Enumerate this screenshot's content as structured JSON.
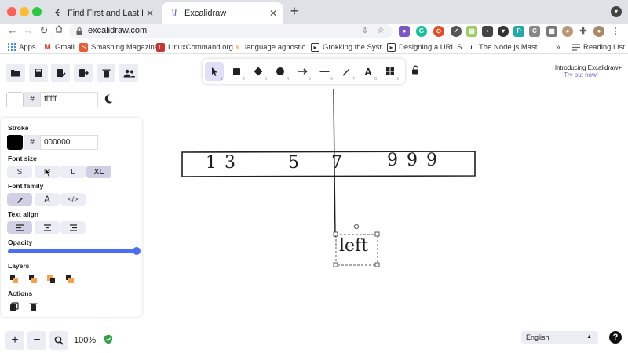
{
  "browser": {
    "tabs": [
      {
        "title": "Find First and Last Position of E",
        "active": false
      },
      {
        "title": "Excalidraw",
        "active": true
      }
    ],
    "url": "excalidraw.com",
    "reading_list": "Reading List",
    "bookmarks": [
      {
        "label": "Apps",
        "icon": "apps-grid-icon"
      },
      {
        "label": "Gmail",
        "icon": "gmail-icon"
      },
      {
        "label": "Smashing Magazine",
        "icon": "smashing-icon"
      },
      {
        "label": "LinuxCommand.org",
        "icon": "linux-icon"
      },
      {
        "label": "language agnostic...",
        "icon": "bookmark-icon"
      },
      {
        "label": "Grokking the Syst...",
        "icon": "grokking-icon"
      },
      {
        "label": "Designing a URL S...",
        "icon": "grokking-icon"
      },
      {
        "label": "The Node.js Mast...",
        "icon": "info-icon"
      }
    ]
  },
  "app": {
    "canvas_bg_hash": "#",
    "canvas_bg_value": "ffffff",
    "stroke_label": "Stroke",
    "stroke_hash": "#",
    "stroke_value": "000000",
    "font_size_label": "Font size",
    "font_sizes": [
      "S",
      "M",
      "L",
      "XL"
    ],
    "font_family_label": "Font family",
    "font_family_a": "A",
    "font_family_code": "</>",
    "text_align_label": "Text align",
    "opacity_label": "Opacity",
    "opacity_value": 100,
    "layers_label": "Layers",
    "actions_label": "Actions",
    "font_family_brand": "A",
    "promo_line1": "Introducing Excalidraw+",
    "promo_line2": "Try out now!",
    "zoom": "100%",
    "language": "English",
    "help": "?"
  },
  "drawing": {
    "array_numbers": [
      "1",
      "3",
      "5",
      "7",
      "9",
      "9",
      "9"
    ],
    "label_text": "left"
  },
  "colors": {
    "accent": "#6965db",
    "slider": "#4c6ef5",
    "selection": "#6965db",
    "tab_strip": "#dee1e6"
  }
}
